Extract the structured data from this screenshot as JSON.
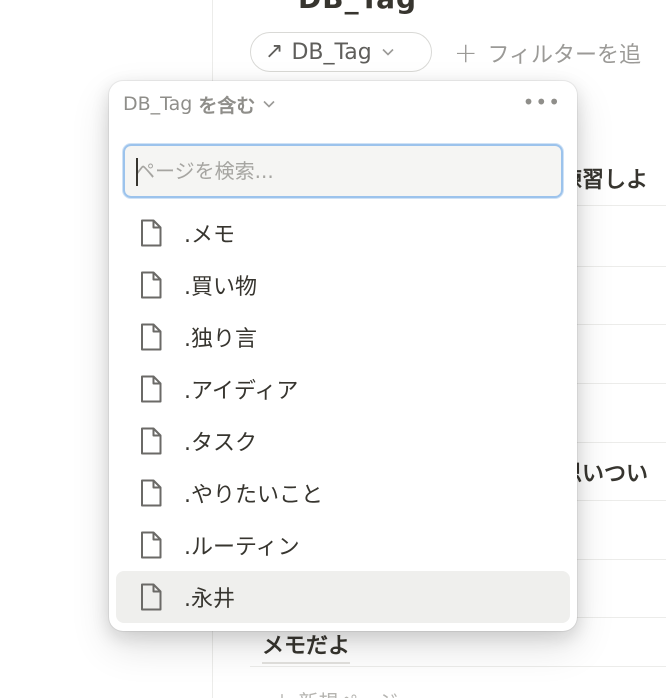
{
  "background": {
    "title_fragment": "DB_Tag",
    "filter_chip": {
      "arrow_glyph": "↗",
      "label": "DB_Tag",
      "chevron": "⌄"
    },
    "add_filter": {
      "plus": "+",
      "label": "フィルターを追"
    },
    "rows": [
      "練習しよ",
      "思いつい",
      "メモだよ"
    ],
    "new_page": "＋ 新規ページ"
  },
  "popup": {
    "property": "DB_Tag",
    "operator": "を含む",
    "more_glyph": "•••",
    "search": {
      "placeholder": "ページを検索...",
      "value": ""
    },
    "items": [
      {
        "label": ".メモ",
        "icon": "page-icon"
      },
      {
        "label": ".買い物",
        "icon": "page-icon"
      },
      {
        "label": ".独り言",
        "icon": "page-icon"
      },
      {
        "label": ".アイディア",
        "icon": "page-icon"
      },
      {
        "label": ".タスク",
        "icon": "page-icon"
      },
      {
        "label": ".やりたいこと",
        "icon": "page-icon"
      },
      {
        "label": ".ルーティン",
        "icon": "page-icon"
      },
      {
        "label": ".永井",
        "icon": "page-icon",
        "hovered": true
      }
    ]
  },
  "colors": {
    "text": "#37352f",
    "muted": "#8f8e8a",
    "focus_ring": "#9cc3ec",
    "hover_bg": "#efefed"
  }
}
